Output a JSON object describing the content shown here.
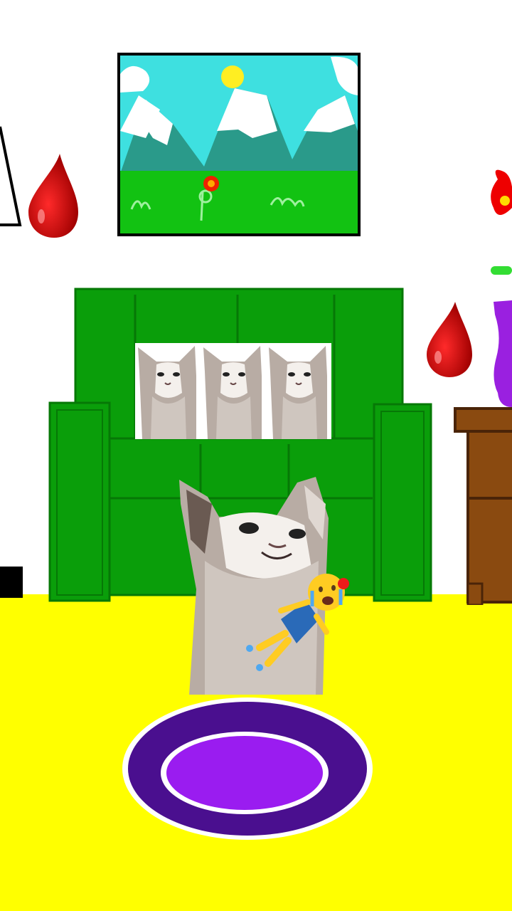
{
  "scene": {
    "name": "living-room-game-scene",
    "colors": {
      "wall": "#ffffff",
      "floor": "#ffff00",
      "sofa": "#0a9e0a",
      "sofa_dark": "#067806",
      "sky": "#3ee0e0",
      "grass": "#12c212",
      "mountain": "#2a9a8a",
      "sun": "#ffee22",
      "drop": "#d00000",
      "rug_outer": "#4a0f8f",
      "rug_inner": "#9a1cf0",
      "cabinet": "#8a4a10",
      "vase": "#9a20e0",
      "flower": "#ee0000",
      "cat_fur": "#b8aca4",
      "cat_white": "#f4f0ec"
    },
    "icons": [
      "blood-drop-icon",
      "crying-face-emoji-icon",
      "flower-icon"
    ]
  }
}
